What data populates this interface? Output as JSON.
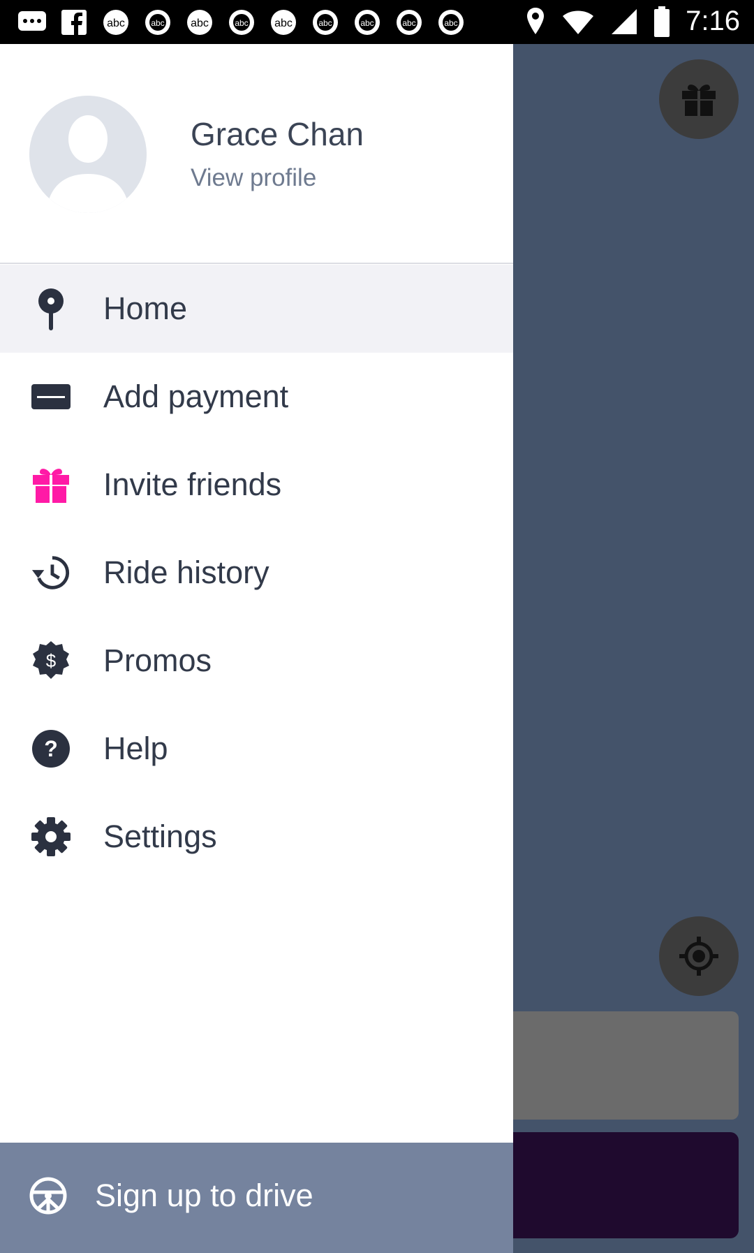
{
  "status_bar": {
    "time": "7:16",
    "notification_icons": [
      "messages-icon",
      "facebook-icon",
      "abc7-icon",
      "abc-icon",
      "abc7-icon",
      "abc-icon",
      "abc7-icon",
      "abc-icon",
      "abc-icon",
      "abc-icon",
      "abc-icon"
    ],
    "system_icons": [
      "location-icon",
      "wifi-icon",
      "signal-icon",
      "battery-icon"
    ]
  },
  "drawer": {
    "profile": {
      "name": "Grace Chan",
      "link": "View profile"
    },
    "menu": [
      {
        "label": "Home",
        "icon": "location-pin-icon",
        "active": true
      },
      {
        "label": "Add payment",
        "icon": "credit-card-icon",
        "active": false
      },
      {
        "label": "Invite friends",
        "icon": "gift-icon",
        "active": false,
        "icon_color": "#ff1aa6"
      },
      {
        "label": "Ride history",
        "icon": "history-icon",
        "active": false
      },
      {
        "label": "Promos",
        "icon": "promo-dollar-icon",
        "active": false
      },
      {
        "label": "Help",
        "icon": "help-icon",
        "active": false
      },
      {
        "label": "Settings",
        "icon": "gear-icon",
        "active": false
      }
    ],
    "footer": {
      "label": "Sign up to drive",
      "icon": "steering-wheel-icon"
    }
  },
  "colors": {
    "drawer_bg": "#ffffff",
    "active_item_bg": "#f2f2f6",
    "footer_bg": "#75839e",
    "invite_icon": "#ff1aa6",
    "overlay_bg": "#44536a"
  }
}
